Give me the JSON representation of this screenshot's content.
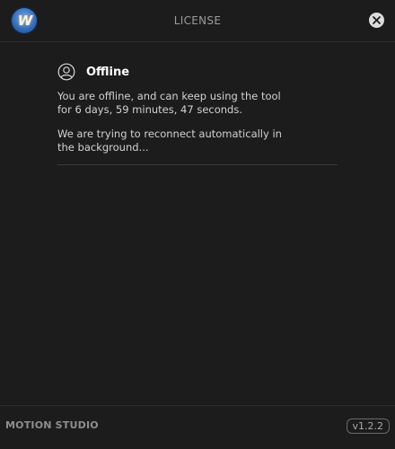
{
  "header": {
    "title": "LICENSE",
    "logo_icon": "motion-studio-logo-icon",
    "close_icon": "close-icon"
  },
  "status": {
    "icon": "user-icon",
    "title": "Offline",
    "message_1": "You are offline, and can keep using the tool for 6 days, 59 minutes, 47 seconds.",
    "message_2": "We are trying to reconnect automatically in the background..."
  },
  "footer": {
    "brand": "MOTION STUDIO",
    "version": "v1.2.2"
  },
  "colors": {
    "background": "#1c1c1c",
    "logo_blue": "#2f66b4",
    "text_primary": "#ffffff",
    "text_secondary": "#d2d2d2"
  }
}
